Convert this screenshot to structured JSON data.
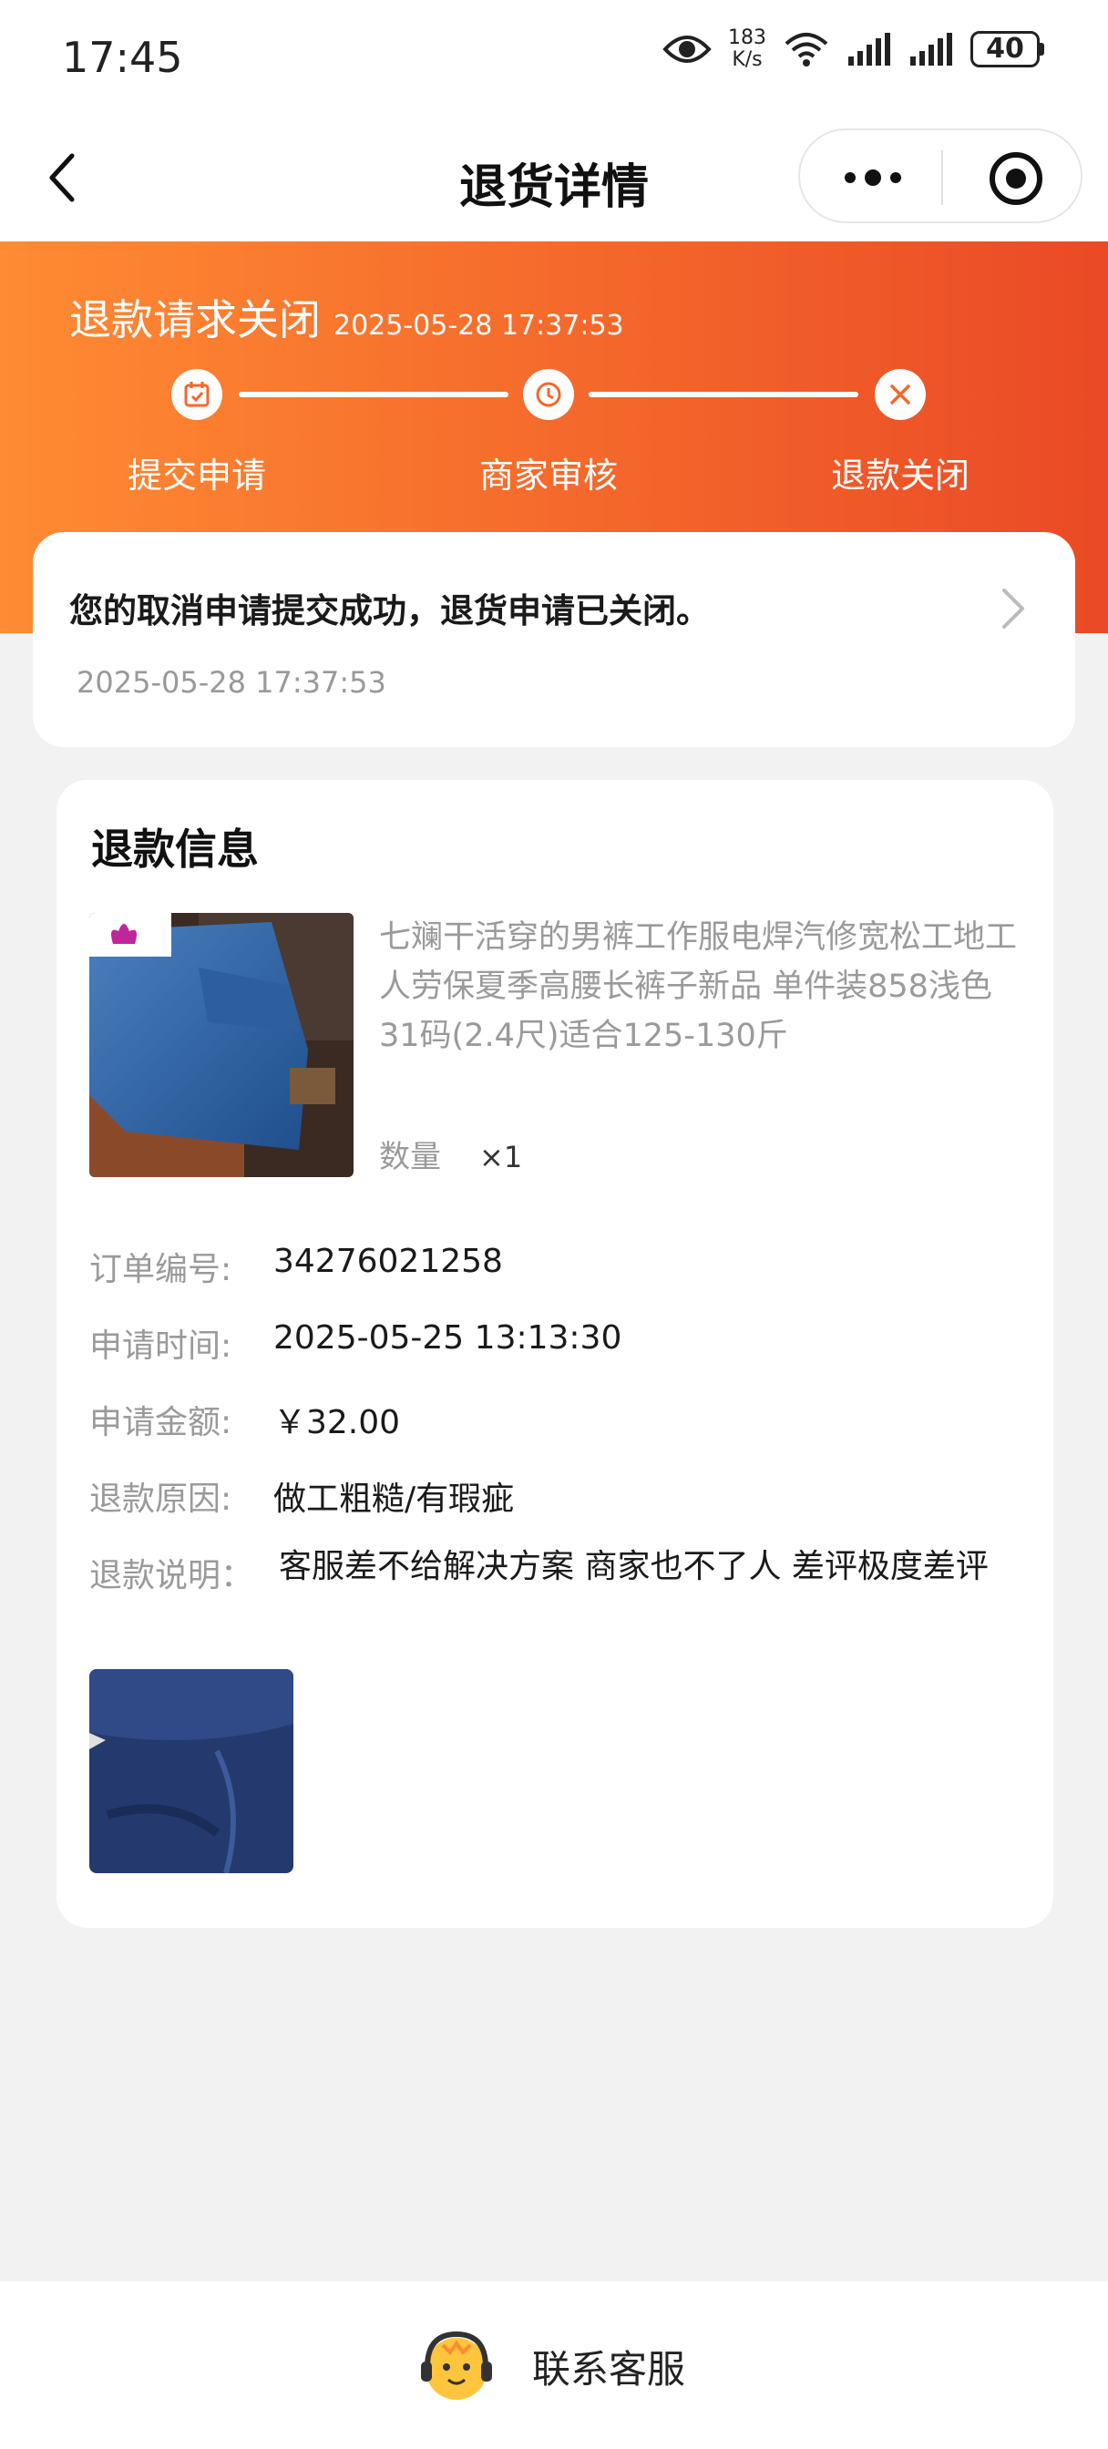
{
  "status_bar": {
    "time": "17:45",
    "net_speed_value": "183",
    "net_speed_unit": "K/s",
    "battery": "40",
    "icons": [
      "eye-icon",
      "wifi-icon",
      "signal-icon",
      "signal-icon",
      "battery-icon"
    ]
  },
  "nav": {
    "title": "退货详情",
    "back_icon": "chevron-left-icon",
    "more_icon": "more-dots-icon",
    "close_icon": "target-icon"
  },
  "banner": {
    "status": "退款请求关闭",
    "time": "2025-05-28 17:37:53",
    "steps": [
      {
        "label": "提交申请",
        "icon": "calendar-check-icon"
      },
      {
        "label": "商家审核",
        "icon": "clock-icon"
      },
      {
        "label": "退款关闭",
        "icon": "close-icon"
      }
    ],
    "colors": {
      "start": "#ff8b33",
      "end": "#ea4a26"
    }
  },
  "notice": {
    "text": "您的取消申请提交成功，退货申请已关闭。",
    "time": "2025-05-28 17:37:53"
  },
  "refund_info": {
    "title": "退款信息",
    "product": {
      "name": "七斓干活穿的男裤工作服电焊汽修宽松工地工人劳保夏季高腰长裤子新品 单件装858浅色 31码(2.4尺)适合125-130斤",
      "qty_label": "数量",
      "qty_value": "×1"
    },
    "fields": [
      {
        "label": "订单编号:",
        "value": "34276021258"
      },
      {
        "label": "申请时间:",
        "value": "2025-05-25 13:13:30"
      },
      {
        "label": "申请金额:",
        "value": "￥32.00"
      },
      {
        "label": "退款原因:",
        "value": "做工粗糙/有瑕疵"
      },
      {
        "label": "退款说明：",
        "value": "客服差不给解决方案 商家也不了人 差评极度差评"
      }
    ]
  },
  "bottom": {
    "contact_label": "联系客服"
  }
}
